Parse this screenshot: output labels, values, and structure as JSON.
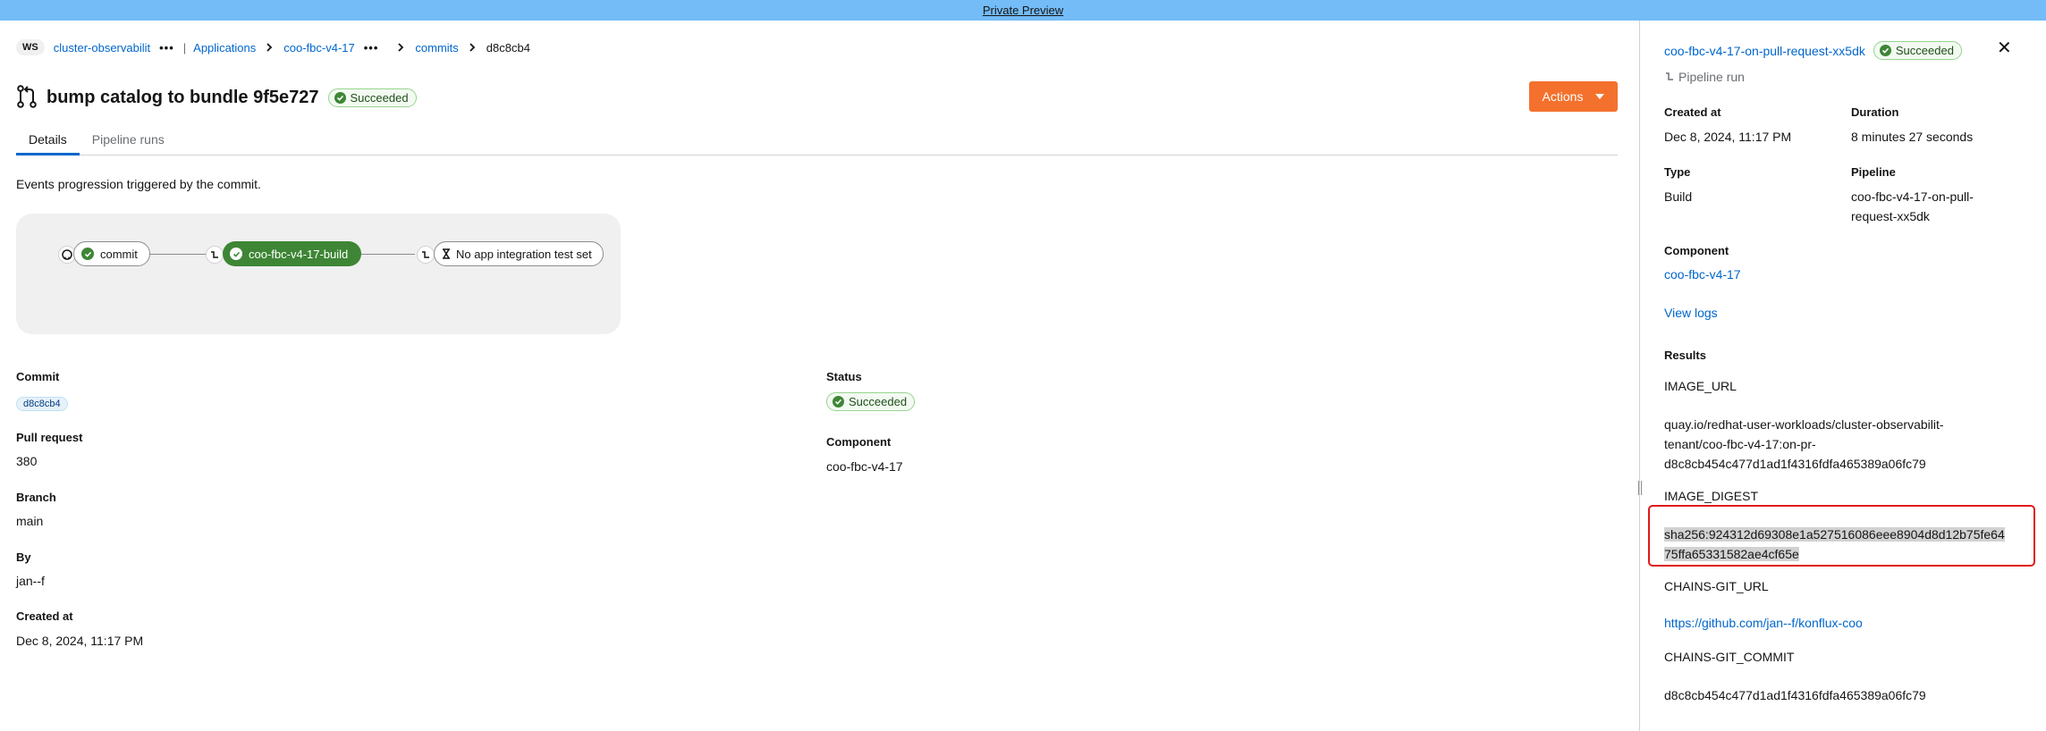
{
  "banner": {
    "text": "Private Preview"
  },
  "breadcrumb": {
    "workspace_badge": "WS",
    "workspace": "cluster-observabilit",
    "dots": "•••",
    "pipe": "|",
    "applications": "Applications",
    "application": "coo-fbc-v4-17",
    "commits": "commits",
    "current": "d8c8cb4"
  },
  "header": {
    "title": "bump catalog to bundle 9f5e727",
    "status": "Succeeded",
    "actions_label": "Actions"
  },
  "tabs": [
    {
      "label": "Details",
      "active": true
    },
    {
      "label": "Pipeline runs",
      "active": false
    }
  ],
  "events": {
    "description": "Events progression triggered by the commit."
  },
  "graph": {
    "nodes": [
      {
        "label": "commit"
      },
      {
        "label": "coo-fbc-v4-17-build"
      },
      {
        "label": "No app integration test set"
      }
    ]
  },
  "details": {
    "commit_label": "Commit",
    "commit_value": "d8c8cb4",
    "pull_request_label": "Pull request",
    "pull_request_value": "380",
    "branch_label": "Branch",
    "branch_value": "main",
    "by_label": "By",
    "by_value": "jan--f",
    "created_label": "Created at",
    "created_value": "Dec 8, 2024, 11:17 PM",
    "status_label": "Status",
    "status_value": "Succeeded",
    "component_label": "Component",
    "component_value": "coo-fbc-v4-17"
  },
  "panel": {
    "title": "coo-fbc-v4-17-on-pull-request-xx5dk",
    "status": "Succeeded",
    "subtitle": "Pipeline run",
    "created_label": "Created at",
    "created_value": "Dec 8, 2024, 11:17 PM",
    "duration_label": "Duration",
    "duration_value": "8 minutes 27 seconds",
    "type_label": "Type",
    "type_value": "Build",
    "pipeline_label": "Pipeline",
    "pipeline_line1": "coo-fbc-v4-17-on-pull-",
    "pipeline_line2": "request-xx5dk",
    "component_label": "Component",
    "component_value": "coo-fbc-v4-17",
    "view_logs": "View logs",
    "results_label": "Results",
    "image_url_key": "IMAGE_URL",
    "image_url_line1": "quay.io/redhat-user-workloads/cluster-observabilit-",
    "image_url_line2": "tenant/coo-fbc-v4-17:on-pr-",
    "image_url_line3": "d8c8cb454c477d1ad1f4316fdfa465389a06fc79",
    "image_digest_key": "IMAGE_DIGEST",
    "image_digest_line1": "sha256:924312d69308e1a527516086eee8904d8d12b75fe64",
    "image_digest_line2": "75ffa65331582ae4cf65e",
    "chains_git_url_key": "CHAINS-GIT_URL",
    "chains_git_url_value": "https://github.com/jan--f/konflux-coo",
    "chains_git_commit_key": "CHAINS-GIT_COMMIT",
    "chains_git_commit_value": "d8c8cb454c477d1ad1f4316fdfa465389a06fc79"
  },
  "colors": {
    "banner": "#73bcf7",
    "link": "#0066cc",
    "success": "#3e8635",
    "actions": "#f4712d",
    "highlight": "#e0191a"
  }
}
